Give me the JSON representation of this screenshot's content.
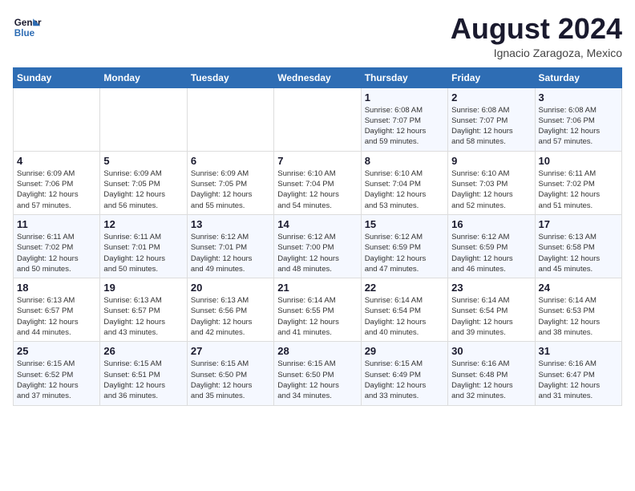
{
  "logo": {
    "line1": "General",
    "line2": "Blue"
  },
  "title": {
    "month_year": "August 2024",
    "location": "Ignacio Zaragoza, Mexico"
  },
  "days_of_week": [
    "Sunday",
    "Monday",
    "Tuesday",
    "Wednesday",
    "Thursday",
    "Friday",
    "Saturday"
  ],
  "weeks": [
    [
      {
        "day": "",
        "info": ""
      },
      {
        "day": "",
        "info": ""
      },
      {
        "day": "",
        "info": ""
      },
      {
        "day": "",
        "info": ""
      },
      {
        "day": "1",
        "info": "Sunrise: 6:08 AM\nSunset: 7:07 PM\nDaylight: 12 hours\nand 59 minutes."
      },
      {
        "day": "2",
        "info": "Sunrise: 6:08 AM\nSunset: 7:07 PM\nDaylight: 12 hours\nand 58 minutes."
      },
      {
        "day": "3",
        "info": "Sunrise: 6:08 AM\nSunset: 7:06 PM\nDaylight: 12 hours\nand 57 minutes."
      }
    ],
    [
      {
        "day": "4",
        "info": "Sunrise: 6:09 AM\nSunset: 7:06 PM\nDaylight: 12 hours\nand 57 minutes."
      },
      {
        "day": "5",
        "info": "Sunrise: 6:09 AM\nSunset: 7:05 PM\nDaylight: 12 hours\nand 56 minutes."
      },
      {
        "day": "6",
        "info": "Sunrise: 6:09 AM\nSunset: 7:05 PM\nDaylight: 12 hours\nand 55 minutes."
      },
      {
        "day": "7",
        "info": "Sunrise: 6:10 AM\nSunset: 7:04 PM\nDaylight: 12 hours\nand 54 minutes."
      },
      {
        "day": "8",
        "info": "Sunrise: 6:10 AM\nSunset: 7:04 PM\nDaylight: 12 hours\nand 53 minutes."
      },
      {
        "day": "9",
        "info": "Sunrise: 6:10 AM\nSunset: 7:03 PM\nDaylight: 12 hours\nand 52 minutes."
      },
      {
        "day": "10",
        "info": "Sunrise: 6:11 AM\nSunset: 7:02 PM\nDaylight: 12 hours\nand 51 minutes."
      }
    ],
    [
      {
        "day": "11",
        "info": "Sunrise: 6:11 AM\nSunset: 7:02 PM\nDaylight: 12 hours\nand 50 minutes."
      },
      {
        "day": "12",
        "info": "Sunrise: 6:11 AM\nSunset: 7:01 PM\nDaylight: 12 hours\nand 50 minutes."
      },
      {
        "day": "13",
        "info": "Sunrise: 6:12 AM\nSunset: 7:01 PM\nDaylight: 12 hours\nand 49 minutes."
      },
      {
        "day": "14",
        "info": "Sunrise: 6:12 AM\nSunset: 7:00 PM\nDaylight: 12 hours\nand 48 minutes."
      },
      {
        "day": "15",
        "info": "Sunrise: 6:12 AM\nSunset: 6:59 PM\nDaylight: 12 hours\nand 47 minutes."
      },
      {
        "day": "16",
        "info": "Sunrise: 6:12 AM\nSunset: 6:59 PM\nDaylight: 12 hours\nand 46 minutes."
      },
      {
        "day": "17",
        "info": "Sunrise: 6:13 AM\nSunset: 6:58 PM\nDaylight: 12 hours\nand 45 minutes."
      }
    ],
    [
      {
        "day": "18",
        "info": "Sunrise: 6:13 AM\nSunset: 6:57 PM\nDaylight: 12 hours\nand 44 minutes."
      },
      {
        "day": "19",
        "info": "Sunrise: 6:13 AM\nSunset: 6:57 PM\nDaylight: 12 hours\nand 43 minutes."
      },
      {
        "day": "20",
        "info": "Sunrise: 6:13 AM\nSunset: 6:56 PM\nDaylight: 12 hours\nand 42 minutes."
      },
      {
        "day": "21",
        "info": "Sunrise: 6:14 AM\nSunset: 6:55 PM\nDaylight: 12 hours\nand 41 minutes."
      },
      {
        "day": "22",
        "info": "Sunrise: 6:14 AM\nSunset: 6:54 PM\nDaylight: 12 hours\nand 40 minutes."
      },
      {
        "day": "23",
        "info": "Sunrise: 6:14 AM\nSunset: 6:54 PM\nDaylight: 12 hours\nand 39 minutes."
      },
      {
        "day": "24",
        "info": "Sunrise: 6:14 AM\nSunset: 6:53 PM\nDaylight: 12 hours\nand 38 minutes."
      }
    ],
    [
      {
        "day": "25",
        "info": "Sunrise: 6:15 AM\nSunset: 6:52 PM\nDaylight: 12 hours\nand 37 minutes."
      },
      {
        "day": "26",
        "info": "Sunrise: 6:15 AM\nSunset: 6:51 PM\nDaylight: 12 hours\nand 36 minutes."
      },
      {
        "day": "27",
        "info": "Sunrise: 6:15 AM\nSunset: 6:50 PM\nDaylight: 12 hours\nand 35 minutes."
      },
      {
        "day": "28",
        "info": "Sunrise: 6:15 AM\nSunset: 6:50 PM\nDaylight: 12 hours\nand 34 minutes."
      },
      {
        "day": "29",
        "info": "Sunrise: 6:15 AM\nSunset: 6:49 PM\nDaylight: 12 hours\nand 33 minutes."
      },
      {
        "day": "30",
        "info": "Sunrise: 6:16 AM\nSunset: 6:48 PM\nDaylight: 12 hours\nand 32 minutes."
      },
      {
        "day": "31",
        "info": "Sunrise: 6:16 AM\nSunset: 6:47 PM\nDaylight: 12 hours\nand 31 minutes."
      }
    ]
  ]
}
